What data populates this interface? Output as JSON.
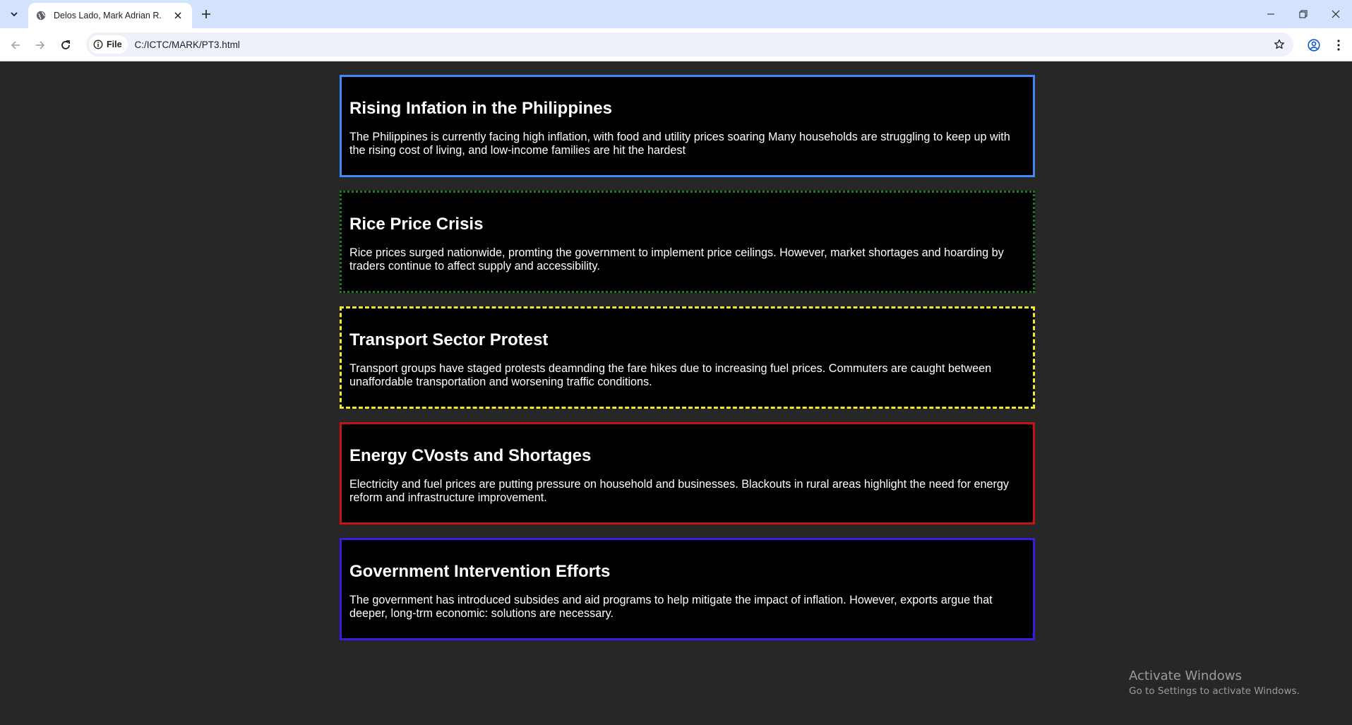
{
  "browser": {
    "tab_title": "Delos Lado, Mark Adrian R.",
    "address": {
      "chip_label": "File",
      "url": "C:/ICTC/MARK/PT3.html"
    },
    "icons": {
      "tab_search": "chevron-down-icon",
      "favicon": "globe-icon",
      "tab_close": "close-icon",
      "new_tab": "plus-icon",
      "minimize": "minimize-icon",
      "restore": "restore-icon",
      "close_window": "close-icon",
      "back": "arrow-left-icon",
      "forward": "arrow-right-icon",
      "reload": "reload-icon",
      "site_info": "info-icon",
      "bookmark": "star-icon",
      "profile": "profile-icon",
      "menu": "more-vertical-icon"
    }
  },
  "articles": [
    {
      "title": "Rising Infation in the Philippines",
      "body": "The Philippines is currently facing high inflation, with food and utility prices soaring Many households are struggling to keep up with the rising cost of living, and low-income families are hit the hardest",
      "border_color": "#3d8af7",
      "border_style": "solid"
    },
    {
      "title": "Rice Price Crisis",
      "body": "Rice prices surged nationwide, promting the government to implement price ceilings. However, market shortages and hoarding by traders continue to affect supply and accessibility.",
      "border_color": "#1f7a1f",
      "border_style": "dotted"
    },
    {
      "title": "Transport Sector Protest",
      "body": "Transport groups have staged protests deamnding the fare hikes due to increasing fuel prices. Commuters are caught between unaffordable transportation and worsening traffic conditions.",
      "border_color": "#f2e92b",
      "border_style": "dashed"
    },
    {
      "title": "Energy CVosts and Shortages",
      "body": "Electricity and fuel prices are putting pressure on household and businesses. Blackouts in rural areas highlight the need for energy reform and infrastructure improvement.",
      "border_color": "#c41414",
      "border_style": "solid"
    },
    {
      "title": "Government Intervention Efforts",
      "body": "The government has introduced subsides and aid programs to help mitigate the impact of inflation. However, exports argue that deeper, long-trm economic: solutions are necessary.",
      "border_color": "#3d1ae0",
      "border_style": "solid"
    }
  ],
  "watermark": {
    "title": "Activate Windows",
    "subtitle": "Go to Settings to activate Windows."
  }
}
